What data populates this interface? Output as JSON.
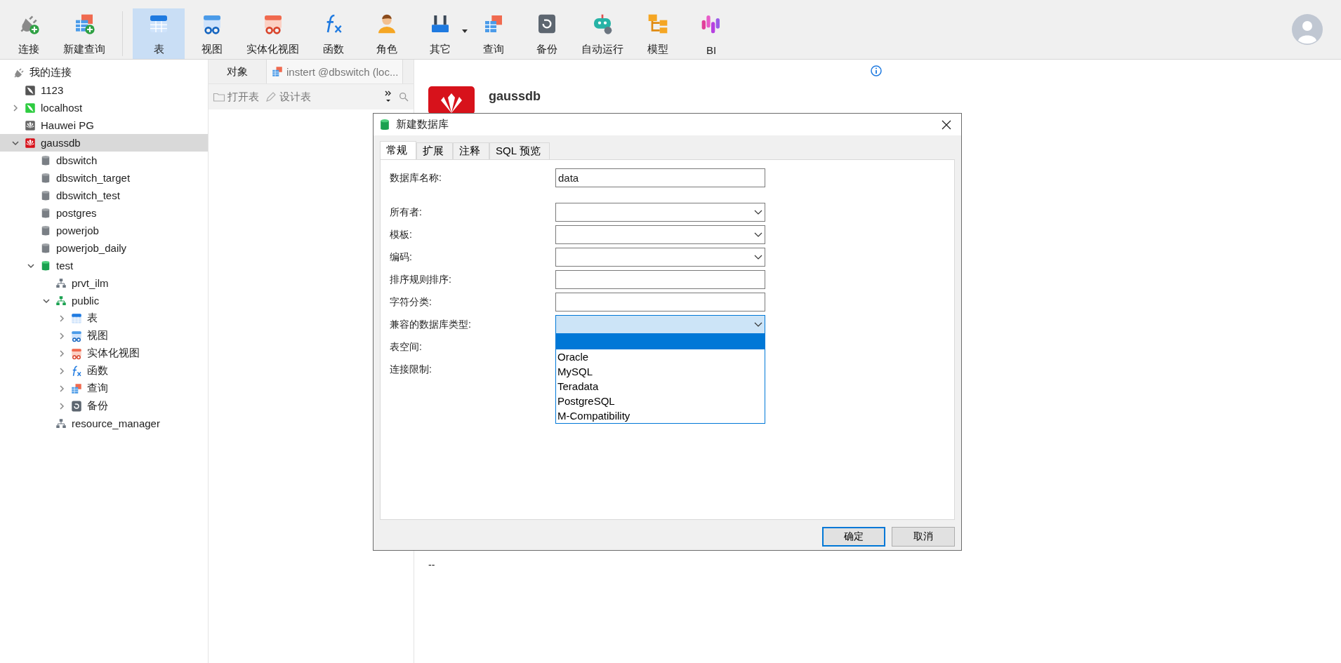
{
  "toolbar": {
    "groups": [
      [
        {
          "label": "连接",
          "kind": "connect",
          "selected": false,
          "dropdown": false
        },
        {
          "label": "新建查询",
          "kind": "new_query",
          "selected": false,
          "dropdown": false
        }
      ],
      [
        {
          "label": "表",
          "kind": "table",
          "selected": true,
          "dropdown": false
        },
        {
          "label": "视图",
          "kind": "view",
          "selected": false,
          "dropdown": false
        },
        {
          "label": "实体化视图",
          "kind": "matview",
          "selected": false,
          "dropdown": false
        },
        {
          "label": "函数",
          "kind": "function",
          "selected": false,
          "dropdown": false
        },
        {
          "label": "角色",
          "kind": "role",
          "selected": false,
          "dropdown": false
        },
        {
          "label": "其它",
          "kind": "other",
          "selected": false,
          "dropdown": true
        },
        {
          "label": "查询",
          "kind": "query",
          "selected": false,
          "dropdown": false
        },
        {
          "label": "备份",
          "kind": "backup",
          "selected": false,
          "dropdown": false
        },
        {
          "label": "自动运行",
          "kind": "automation",
          "selected": false,
          "dropdown": false
        },
        {
          "label": "模型",
          "kind": "model",
          "selected": false,
          "dropdown": false
        },
        {
          "label": "BI",
          "kind": "bi",
          "selected": false,
          "dropdown": false
        }
      ]
    ]
  },
  "sidebar": {
    "title": "我的连接",
    "tree": [
      {
        "label": "1123",
        "kind": "conn_gray",
        "selected": false
      },
      {
        "label": "localhost",
        "kind": "conn_green",
        "expanded": false,
        "selected": false
      },
      {
        "label": "Hauwei PG",
        "kind": "huawei_gray",
        "selected": false
      },
      {
        "label": "gaussdb",
        "kind": "huawei_red",
        "expanded": true,
        "selected": true,
        "children": [
          {
            "label": "dbswitch",
            "kind": "db_gray",
            "selected": false
          },
          {
            "label": "dbswitch_target",
            "kind": "db_gray",
            "selected": false
          },
          {
            "label": "dbswitch_test",
            "kind": "db_gray",
            "selected": false
          },
          {
            "label": "postgres",
            "kind": "db_gray",
            "selected": false
          },
          {
            "label": "powerjob",
            "kind": "db_gray",
            "selected": false
          },
          {
            "label": "powerjob_daily",
            "kind": "db_gray",
            "selected": false
          },
          {
            "label": "test",
            "kind": "db_green",
            "expanded": true,
            "selected": false,
            "children": [
              {
                "label": "prvt_ilm",
                "kind": "schema_gray",
                "selected": false
              },
              {
                "label": "public",
                "kind": "schema_green",
                "expanded": true,
                "selected": false,
                "children": [
                  {
                    "label": "表",
                    "kind": "table",
                    "expanded": false,
                    "selected": false
                  },
                  {
                    "label": "视图",
                    "kind": "view",
                    "expanded": false,
                    "selected": false
                  },
                  {
                    "label": "实体化视图",
                    "kind": "matview",
                    "expanded": false,
                    "selected": false
                  },
                  {
                    "label": "函数",
                    "kind": "function",
                    "expanded": false,
                    "selected": false
                  },
                  {
                    "label": "查询",
                    "kind": "query",
                    "expanded": false,
                    "selected": false
                  },
                  {
                    "label": "备份",
                    "kind": "backup",
                    "expanded": false,
                    "selected": false
                  }
                ]
              },
              {
                "label": "resource_manager",
                "kind": "schema_gray",
                "selected": false
              }
            ]
          }
        ]
      }
    ]
  },
  "objects": {
    "tabs": [
      {
        "label": "对象",
        "kind": "plain",
        "selected": false
      },
      {
        "label": "instert @dbswitch (loc...",
        "kind": "query",
        "selected": true
      }
    ],
    "actions": [
      {
        "label": "打开表",
        "kind": "folder",
        "disabled": true
      },
      {
        "label": "设计表",
        "kind": "pencil",
        "disabled": true
      }
    ]
  },
  "details": {
    "title": "gaussdb",
    "value": "--"
  },
  "dialog": {
    "title": "新建数据库",
    "tabs": [
      {
        "label": "常规",
        "selected": true
      },
      {
        "label": "扩展",
        "selected": false
      },
      {
        "label": "注释",
        "selected": false
      },
      {
        "label": "SQL 预览",
        "selected": false
      }
    ],
    "fields": [
      {
        "label": "数据库名称:",
        "kind": "text",
        "value": "data",
        "focused": false
      },
      {
        "label": "所有者:",
        "kind": "select",
        "focused": false
      },
      {
        "label": "模板:",
        "kind": "select",
        "focused": false
      },
      {
        "label": "编码:",
        "kind": "select",
        "focused": false
      },
      {
        "label": "排序规则排序:",
        "kind": "text",
        "focused": false
      },
      {
        "label": "字符分类:",
        "kind": "text",
        "focused": false
      },
      {
        "label": "兼容的数据库类型:",
        "kind": "select",
        "focused": true,
        "blank_selected": true,
        "options": [
          {
            "label": "Oracle",
            "selected": false
          },
          {
            "label": "MySQL",
            "selected": false
          },
          {
            "label": "Teradata",
            "selected": false
          },
          {
            "label": "PostgreSQL",
            "selected": false
          },
          {
            "label": "M-Compatibility",
            "selected": false
          }
        ]
      },
      {
        "label": "表空间:",
        "kind": "covered"
      },
      {
        "label": "连接限制:",
        "kind": "covered"
      }
    ],
    "buttons": [
      {
        "label": "确定",
        "default": true
      },
      {
        "label": "取消",
        "default": false
      }
    ]
  }
}
